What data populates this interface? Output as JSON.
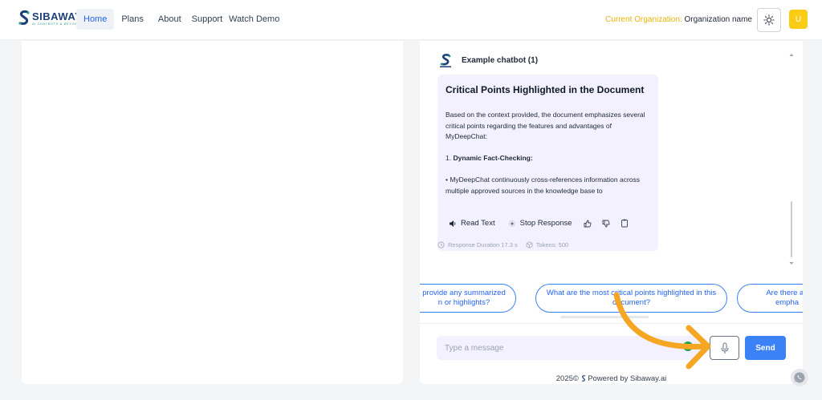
{
  "header": {
    "logo_name": "SIBAWAY",
    "logo_tagline": "AI CHATBOTS & BEYOND",
    "nav": [
      "Home",
      "Plans",
      "About",
      "Support",
      "Watch Demo"
    ],
    "org_label": "Current Organization:",
    "org_name": "Organization name",
    "avatar_initial": "U"
  },
  "chat": {
    "bot_name": "Example chatbot (1)",
    "message": {
      "title": "Critical Points Highlighted in the Document",
      "intro": "Based on the context provided, the document emphasizes several critical points regarding the features and advantages of MyDeepChat:",
      "point_number": "1.",
      "point_title": "Dynamic Fact-Checking:",
      "bullet": "• MyDeepChat continuously cross-references information across multiple approved sources in the knowledge base to",
      "actions": {
        "read_text": "Read Text",
        "stop_response": "Stop Response"
      },
      "meta": {
        "duration": "Response Duration 17.3 s",
        "tokens": "Tokens: 500"
      }
    },
    "suggestions": [
      "provide any summarized n or highlights?",
      "What are the most critical points highlighted in this document?",
      "Are there an empha"
    ],
    "input": {
      "placeholder": "Type a message",
      "grammar_badge": "G"
    },
    "send_label": "Send",
    "footer_year": "2025©",
    "footer_text": "Powered by Sibaway.ai"
  },
  "colors": {
    "accent": "#3b82f6",
    "org_label": "#eab308",
    "avatar": "#facc15",
    "annotation_arrow": "#f5a623",
    "message_bg": "#f3f1ff"
  }
}
